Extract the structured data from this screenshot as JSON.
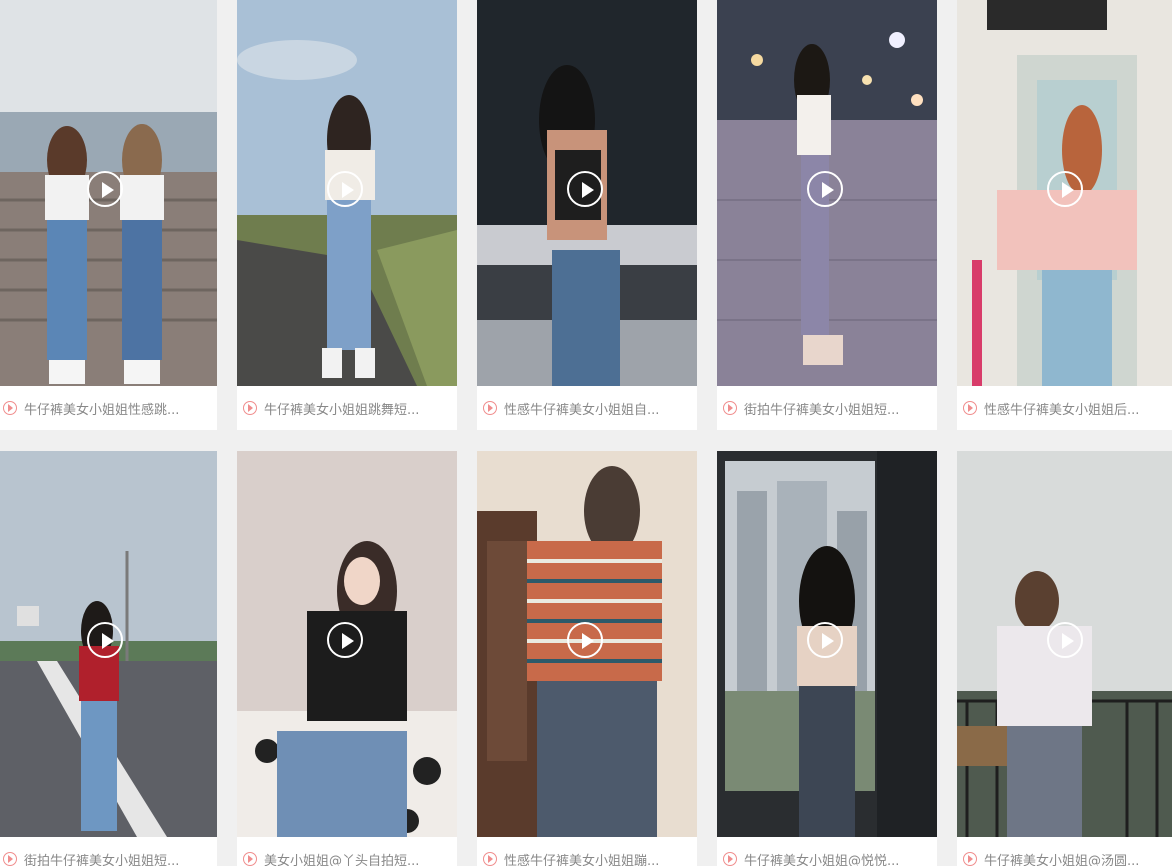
{
  "videos": [
    {
      "title": "牛仔裤美女小姐姐性感跳...",
      "palette": {
        "sky": "#dfe3e6",
        "ground": "#8a7e78",
        "accent": "#5b86b6"
      }
    },
    {
      "title": "牛仔裤美女小姐姐跳舞短...",
      "palette": {
        "sky": "#a9c0d6",
        "ground": "#6f7d4e",
        "accent": "#7ea0c8"
      }
    },
    {
      "title": "性感牛仔裤美女小姐姐自...",
      "palette": {
        "sky": "#20262c",
        "ground": "#c9cbd0",
        "accent": "#4d6f94"
      }
    },
    {
      "title": "街拍牛仔裤美女小姐姐短...",
      "palette": {
        "sky": "#3b4150",
        "ground": "#8a8298",
        "accent": "#8c86a8"
      }
    },
    {
      "title": "性感牛仔裤美女小姐姐后...",
      "palette": {
        "sky": "#e9e6e0",
        "ground": "#cfd6d0",
        "accent": "#8fb7cf"
      }
    },
    {
      "title": "街拍牛仔裤美女小姐姐短...",
      "palette": {
        "sky": "#b8c4cf",
        "ground": "#5e6066",
        "accent": "#6e97c2"
      }
    },
    {
      "title": "美女小姐姐@丫头自拍短...",
      "palette": {
        "sky": "#e4dcd8",
        "ground": "#3a3a3a",
        "accent": "#6f8fb5"
      }
    },
    {
      "title": "性感牛仔裤美女小姐姐蹦...",
      "palette": {
        "sky": "#e8ddd0",
        "ground": "#5a3b2c",
        "accent": "#4d5a6c"
      }
    },
    {
      "title": "牛仔裤美女小姐姐@悦悦...",
      "palette": {
        "sky": "#c6ccd1",
        "ground": "#2a2d30",
        "accent": "#3d4654"
      }
    },
    {
      "title": "牛仔裤美女小姐姐@汤圆...",
      "palette": {
        "sky": "#d8dbda",
        "ground": "#4f5a4f",
        "accent": "#6e7686"
      }
    }
  ]
}
